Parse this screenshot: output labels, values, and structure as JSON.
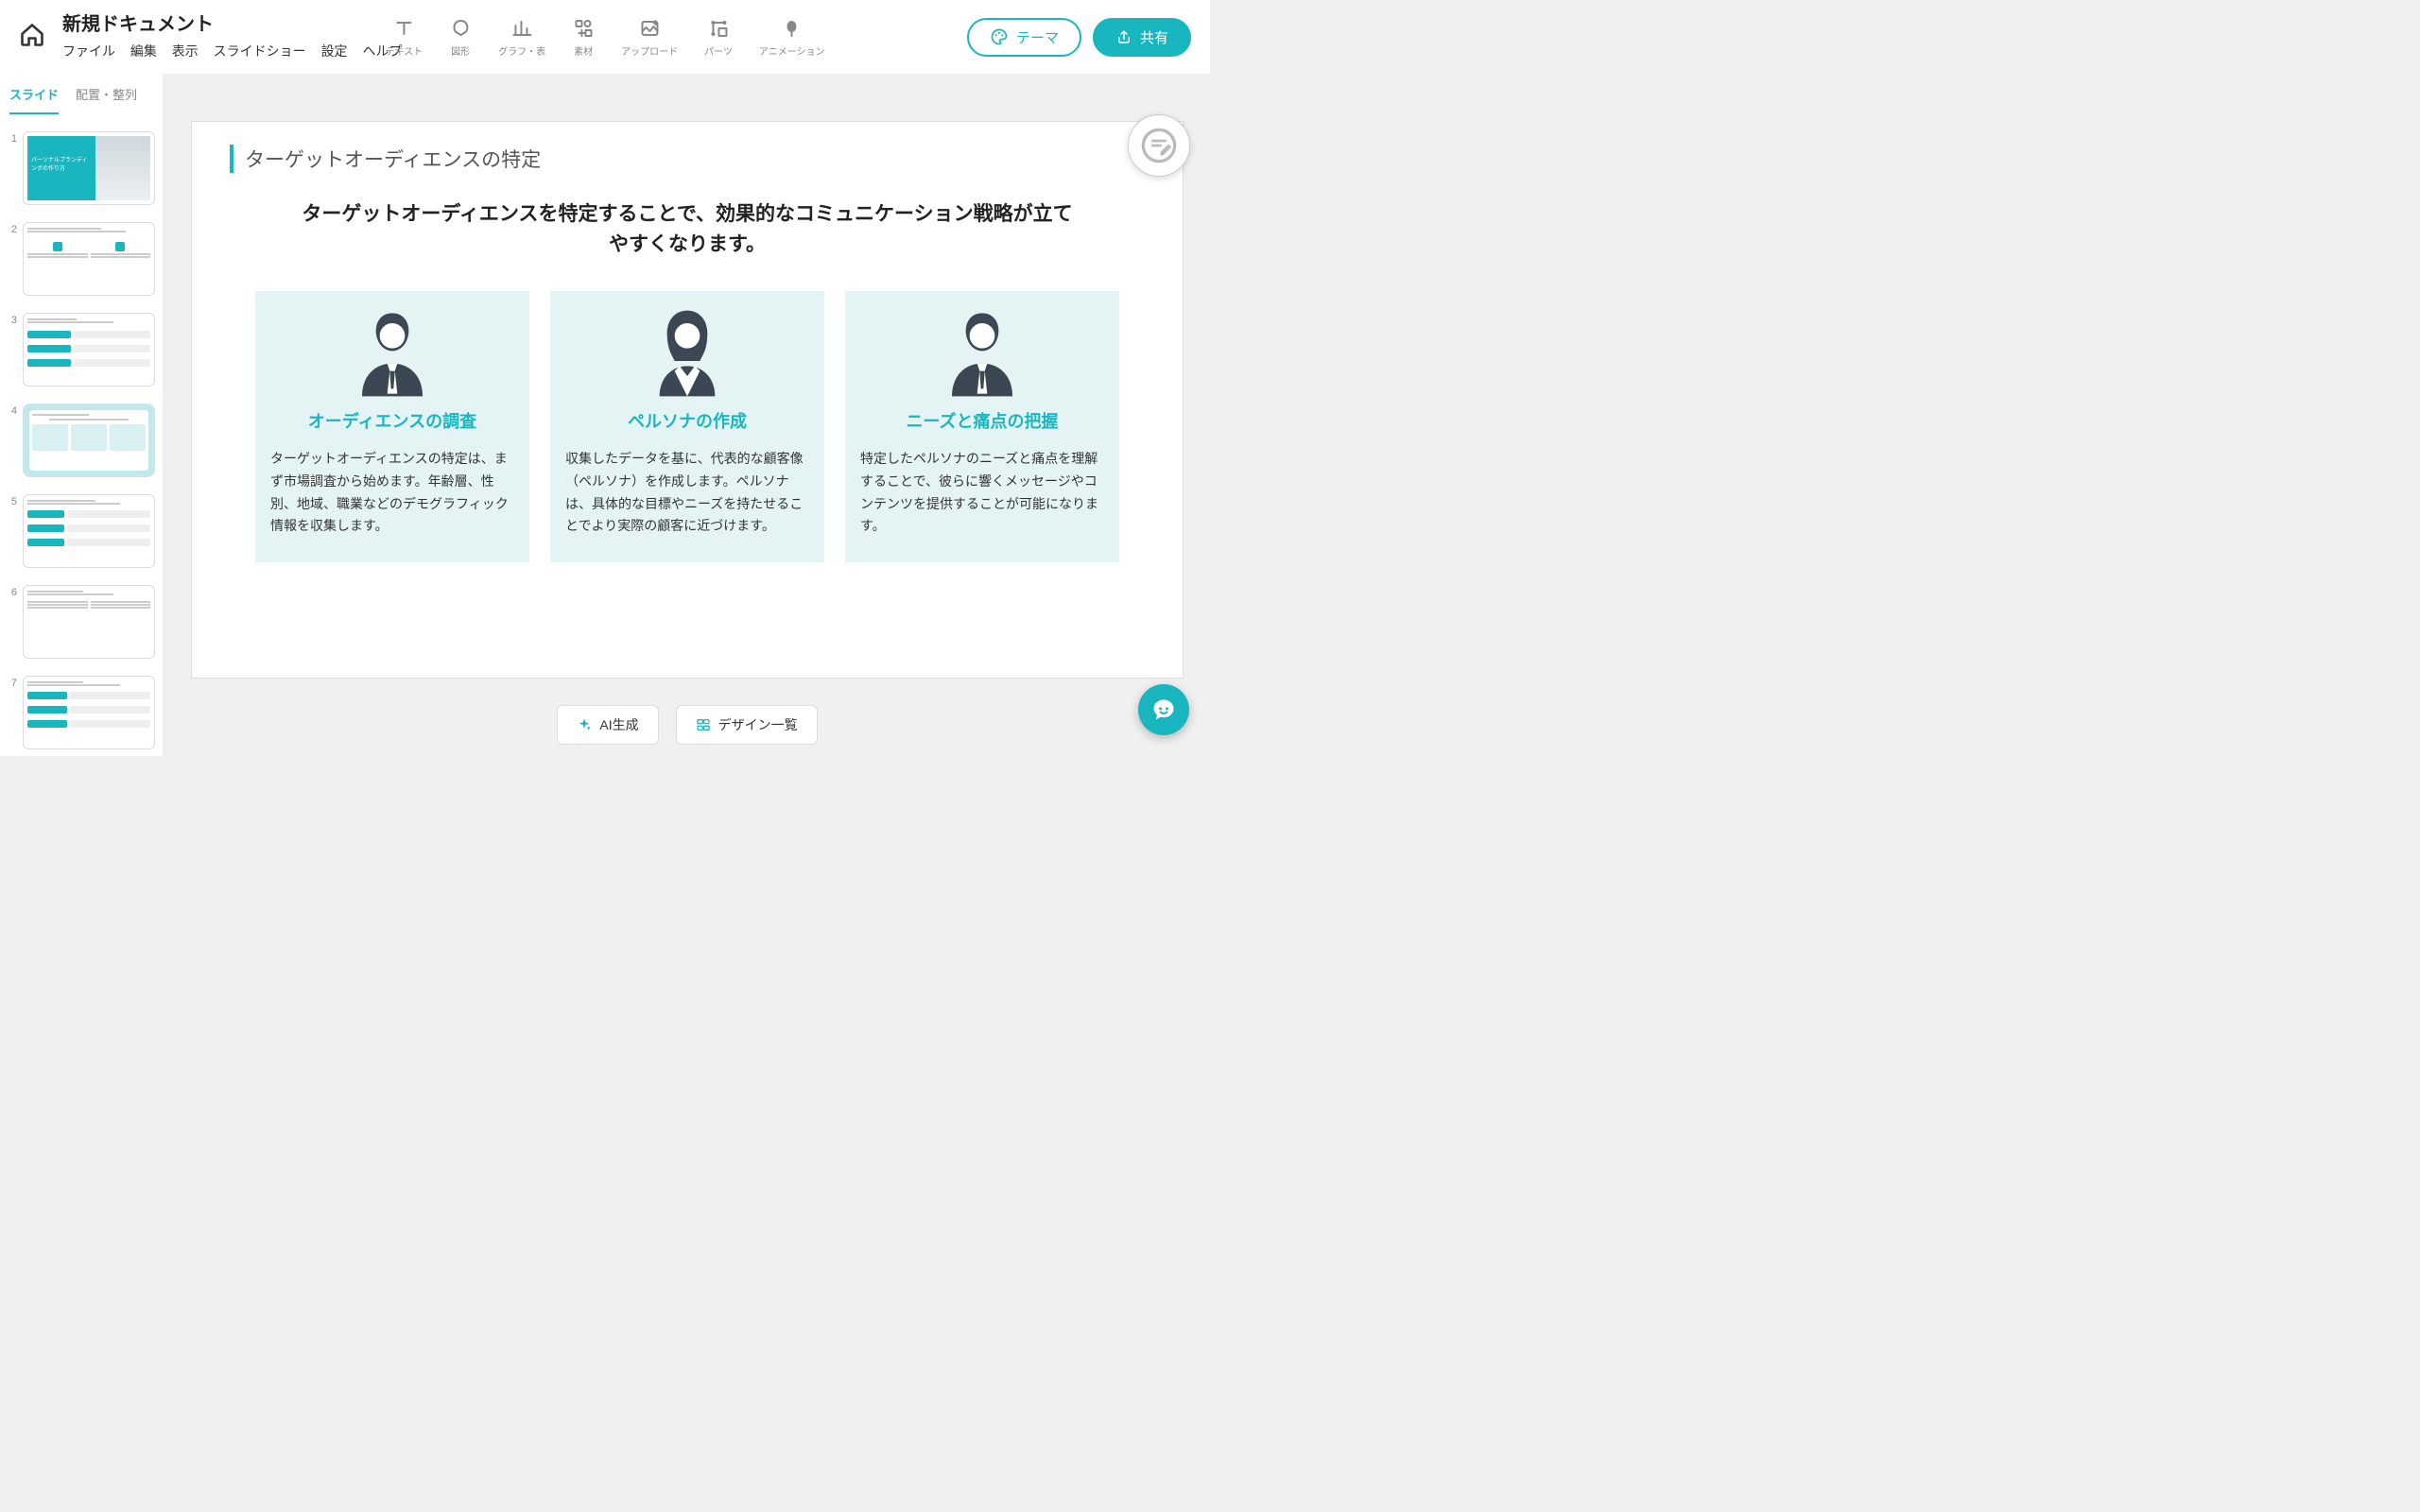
{
  "header": {
    "doc_title": "新規ドキュメント",
    "menu": {
      "file": "ファイル",
      "edit": "編集",
      "view": "表示",
      "slideshow": "スライドショー",
      "settings": "設定",
      "help": "ヘルプ"
    },
    "tools": {
      "text": "テキスト",
      "shape": "図形",
      "chart": "グラフ・表",
      "asset": "素材",
      "upload": "アップロード",
      "parts": "パーツ",
      "anim": "アニメーション"
    },
    "theme_btn": "テーマ",
    "share_btn": "共有"
  },
  "left": {
    "tab_slides": "スライド",
    "tab_arrange": "配置・整列",
    "selected_index": 4,
    "thumbs": [
      {
        "n": "1",
        "title": "パーソナルブランディングの作り方"
      },
      {
        "n": "2"
      },
      {
        "n": "3"
      },
      {
        "n": "4"
      },
      {
        "n": "5"
      },
      {
        "n": "6"
      },
      {
        "n": "7"
      }
    ]
  },
  "slide": {
    "title": "ターゲットオーディエンスの特定",
    "lead": "ターゲットオーディエンスを特定することで、効果的なコミュニケーション戦略が立てやすくなります。",
    "cards": [
      {
        "heading": "オーディエンスの調査",
        "body": "ターゲットオーディエンスの特定は、まず市場調査から始めます。年齢層、性別、地域、職業などのデモグラフィック情報を収集します。"
      },
      {
        "heading": "ペルソナの作成",
        "body": "収集したデータを基に、代表的な顧客像（ペルソナ）を作成します。ペルソナは、具体的な目標やニーズを持たせることでより実際の顧客に近づけます。"
      },
      {
        "heading": "ニーズと痛点の把握",
        "body": "特定したペルソナのニーズと痛点を理解することで、彼らに響くメッセージやコンテンツを提供することが可能になります。"
      }
    ]
  },
  "bottom": {
    "ai": "AI生成",
    "designs": "デザイン一覧"
  }
}
